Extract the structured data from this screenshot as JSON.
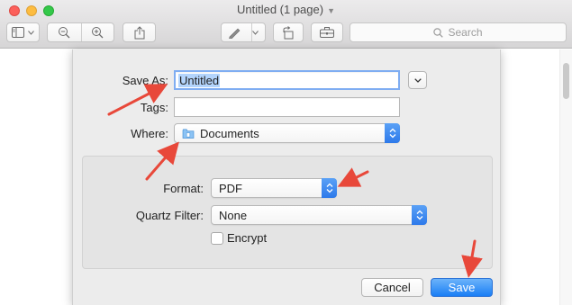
{
  "window": {
    "title": "Untitled (1 page)",
    "title_chevron_icon": "chevron-down-icon"
  },
  "toolbar": {
    "search_placeholder": "Search",
    "icons": [
      "sidebar-icon",
      "chevron-down-icon",
      "zoom-out-icon",
      "zoom-in-icon",
      "share-icon",
      "markup-pen-icon",
      "chevron-down-icon",
      "rotate-icon",
      "toolbox-icon",
      "search-icon"
    ]
  },
  "save_sheet": {
    "save_as_label": "Save As:",
    "save_as_value": "Untitled",
    "tags_label": "Tags:",
    "tags_value": "",
    "where_label": "Where:",
    "where_value": "Documents",
    "format_label": "Format:",
    "format_value": "PDF",
    "quartz_filter_label": "Quartz Filter:",
    "quartz_filter_value": "None",
    "encrypt_label": "Encrypt",
    "encrypt_checked": false,
    "cancel_label": "Cancel",
    "save_label": "Save"
  },
  "annotations": {
    "arrow_color": "#e8483a",
    "arrow_targets": [
      "save-as-label",
      "where-popup",
      "format-popup",
      "save-button"
    ]
  },
  "colors": {
    "accent_blue": "#2d79ea",
    "selection": "#b3d4fc"
  }
}
